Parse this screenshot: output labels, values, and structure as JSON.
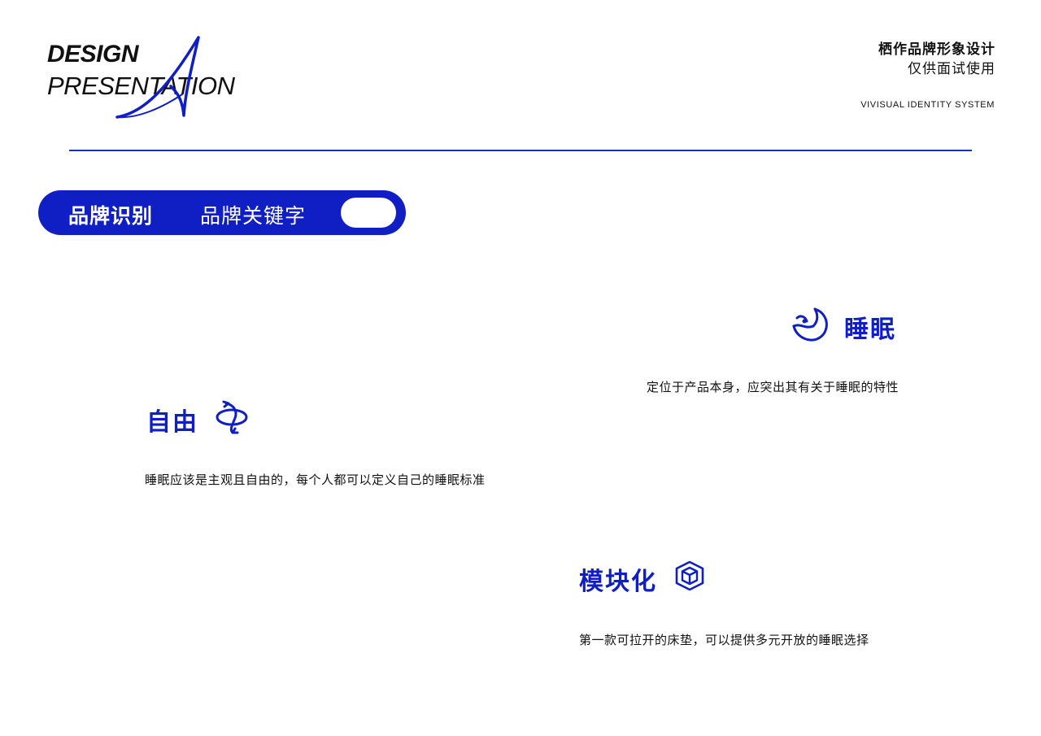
{
  "header": {
    "logo_line1": "DESIGN",
    "logo_line2": "PRESENTATION",
    "title": "栖作品牌形象设计",
    "subtitle": "仅供面试使用",
    "system_label": "VIVISUAL IDENTITY SYSTEM"
  },
  "tag": {
    "primary": "品牌识别",
    "secondary": "品牌关键字"
  },
  "keywords": {
    "sleep": {
      "title": "睡眠",
      "desc": "定位于产品本身，应突出其有关于睡眠的特性",
      "icon": "moon-sleep-icon"
    },
    "free": {
      "title": "自由",
      "desc": "睡眠应该是主观且自由的，每个人都可以定义自己的睡眠标准",
      "icon": "orbit-arrows-icon"
    },
    "modular": {
      "title": "模块化",
      "desc": "第一款可拉开的床垫，可以提供多元开放的睡眠选择",
      "icon": "cube-icon"
    }
  },
  "colors": {
    "accent": "#0f1fc4",
    "text": "#111111",
    "background": "#ffffff"
  }
}
